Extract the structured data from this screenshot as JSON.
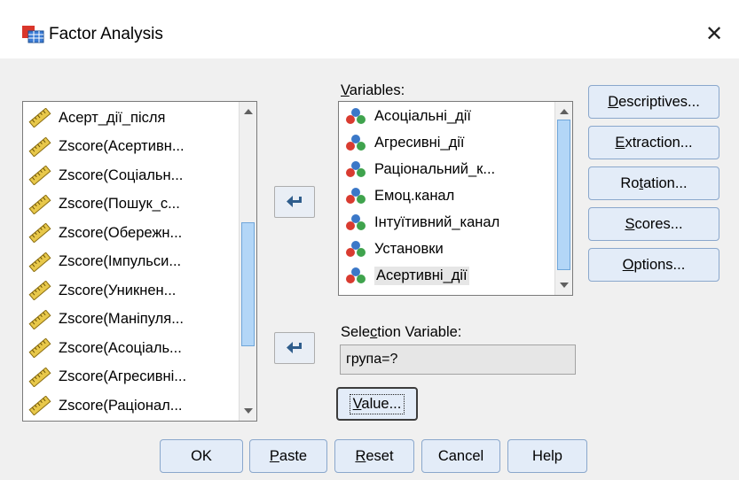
{
  "window": {
    "title": "Factor Analysis",
    "close_glyph": "✕"
  },
  "source_list": {
    "items": [
      {
        "label": "Асерт_дії_після",
        "icon": "scale-ruler-icon"
      },
      {
        "label": "Zscore(Асертивн...",
        "icon": "scale-ruler-icon"
      },
      {
        "label": "Zscore(Соціальн...",
        "icon": "scale-ruler-icon"
      },
      {
        "label": "Zscore(Пошук_с...",
        "icon": "scale-ruler-icon"
      },
      {
        "label": "Zscore(Обережн...",
        "icon": "scale-ruler-icon"
      },
      {
        "label": "Zscore(Імпульси...",
        "icon": "scale-ruler-icon"
      },
      {
        "label": "Zscore(Уникнен...",
        "icon": "scale-ruler-icon"
      },
      {
        "label": "Zscore(Маніпуля...",
        "icon": "scale-ruler-icon"
      },
      {
        "label": "Zscore(Асоціаль...",
        "icon": "scale-ruler-icon"
      },
      {
        "label": "Zscore(Агресивні...",
        "icon": "scale-ruler-icon"
      },
      {
        "label": "Zscore(Раціонал...",
        "icon": "scale-ruler-icon"
      }
    ]
  },
  "variables": {
    "label_prefix": "",
    "label_underlined": "V",
    "label_rest": "ariables:",
    "items": [
      {
        "label": "Асоціальні_дії",
        "icon": "nominal-variable-icon"
      },
      {
        "label": "Агресивні_дії",
        "icon": "nominal-variable-icon"
      },
      {
        "label": "Раціональний_к...",
        "icon": "nominal-variable-icon"
      },
      {
        "label": "Емоц.канал",
        "icon": "nominal-variable-icon"
      },
      {
        "label": "Інтуїтивний_канал",
        "icon": "nominal-variable-icon"
      },
      {
        "label": "Установки",
        "icon": "nominal-variable-icon"
      },
      {
        "label": "Асертивні_дії",
        "icon": "nominal-variable-icon",
        "selected": true
      }
    ]
  },
  "selection": {
    "label_prefix": "Sele",
    "label_underlined": "c",
    "label_rest": "tion Variable:",
    "value": "група=?",
    "value_button": {
      "prefix": "",
      "underlined": "V",
      "rest": "alue..."
    }
  },
  "side_buttons": [
    {
      "prefix": "",
      "underlined": "D",
      "rest": "escriptives..."
    },
    {
      "prefix": "",
      "underlined": "E",
      "rest": "xtraction..."
    },
    {
      "prefix": "Ro",
      "underlined": "t",
      "rest": "ation..."
    },
    {
      "prefix": "",
      "underlined": "S",
      "rest": "cores..."
    },
    {
      "prefix": "",
      "underlined": "O",
      "rest": "ptions..."
    }
  ],
  "bottom_buttons": [
    {
      "prefix": "OK",
      "underlined": "",
      "rest": ""
    },
    {
      "prefix": "",
      "underlined": "P",
      "rest": "aste"
    },
    {
      "prefix": "",
      "underlined": "R",
      "rest": "eset"
    },
    {
      "prefix": "Cancel",
      "underlined": "",
      "rest": ""
    },
    {
      "prefix": "Help",
      "underlined": "",
      "rest": ""
    }
  ],
  "colors": {
    "button_fill": "#e3ecf8",
    "button_border": "#8aa7cc",
    "arrow_blue": "#2f5d8c",
    "dialog_bg": "#f0f0f0"
  }
}
